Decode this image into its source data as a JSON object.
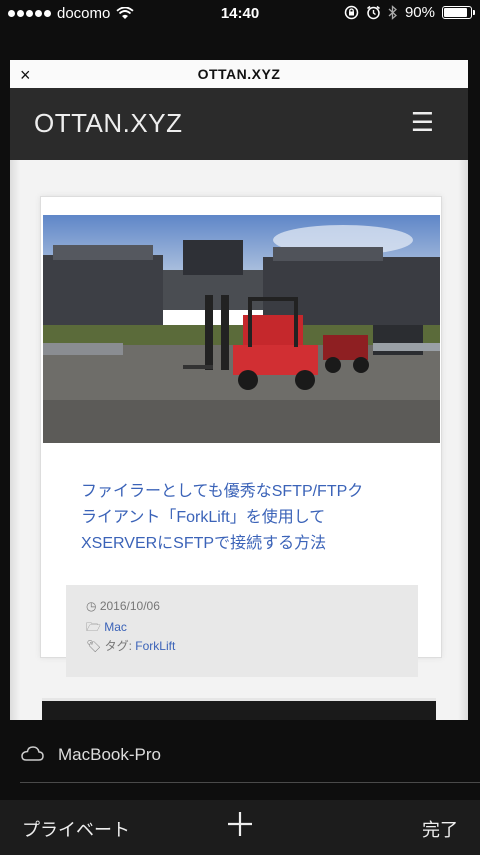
{
  "status": {
    "carrier": "docomo",
    "time": "14:40",
    "battery": "90%",
    "battery_level": 0.9
  },
  "tab": {
    "title": "OTTAN.XYZ",
    "close_glyph": "×"
  },
  "site": {
    "logo": "OTTAN.XYZ",
    "menu_glyph": "☰"
  },
  "article": {
    "headline_lines": [
      "ファイラーとしても優秀なSFTP/FTPク",
      "ライアント「ForkLift」を使用して",
      "XSERVERにSFTPで接続する方法"
    ],
    "date": "2016/10/06",
    "category": "Mac",
    "tag_label": "タグ:",
    "tag": "ForkLift"
  },
  "device": {
    "name": "MacBook-Pro"
  },
  "toolbar": {
    "private_label": "プライベート",
    "done_label": "完了"
  }
}
